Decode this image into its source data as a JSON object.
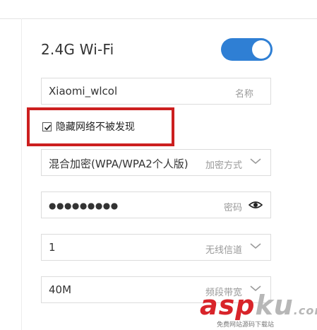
{
  "wifi": {
    "title": "2.4G Wi-Fi",
    "enabled": true,
    "accent_color": "#2f7fd4"
  },
  "fields": {
    "name": {
      "value": "Xiaomi_wlcol",
      "label": "名称"
    },
    "hide_network": {
      "label": "隐藏网络不被发现",
      "checked": true
    },
    "encryption": {
      "value": "混合加密(WPA/WPA2个人版)",
      "label": "加密方式",
      "icon": "chevron-down-icon"
    },
    "password": {
      "value": "●●●●●●●●●",
      "label": "密码",
      "icon": "eye-icon"
    },
    "channel": {
      "value": "1",
      "label": "无线信道",
      "icon": "chevron-down-icon"
    },
    "bandwidth": {
      "value": "40M",
      "label": "频段带宽",
      "icon": "chevron-down-icon"
    }
  },
  "highlight_color": "#cc1f1f",
  "watermark": {
    "logo_red": "asp",
    "logo_gray": "ku",
    "logo_suffix": ".com",
    "subtitle": "免费网站源码下载站"
  }
}
